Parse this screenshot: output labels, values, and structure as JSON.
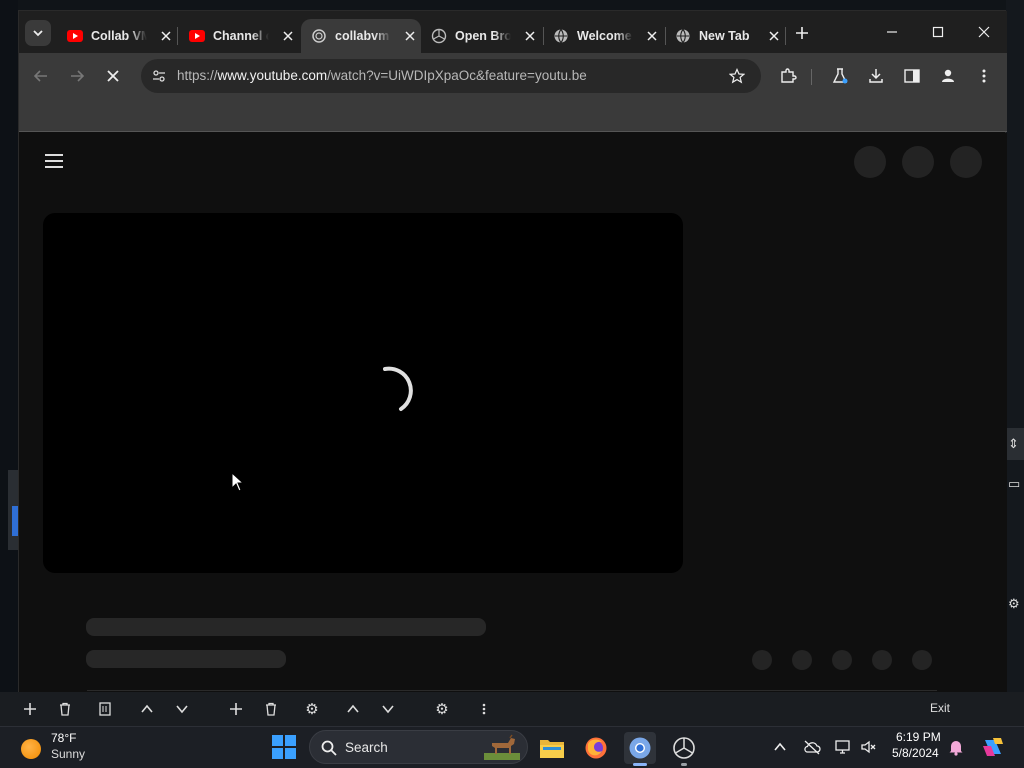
{
  "browser": {
    "tabs": [
      {
        "title": "Collab VM",
        "favicon": "youtube-icon",
        "active": false
      },
      {
        "title": "Channel c",
        "favicon": "youtube-icon",
        "active": false
      },
      {
        "title": "collabvm",
        "favicon": "loading-icon",
        "active": true
      },
      {
        "title": "Open Bro",
        "favicon": "openbrowser-icon",
        "active": false
      },
      {
        "title": "Welcome",
        "favicon": "globe-icon",
        "active": false
      },
      {
        "title": "New Tab",
        "favicon": "globe-icon",
        "active": false
      }
    ],
    "url_scheme": "https://",
    "url_domain": "www.youtube.com",
    "url_path": "/watch?v=UiWDIpXpaOc&feature=youtu.be",
    "loading": true
  },
  "app_strip": {
    "exit_label": "Exit"
  },
  "taskbar": {
    "weather_temp": "78°F",
    "weather_condition": "Sunny",
    "search_label": "Search",
    "clock_time": "6:19 PM",
    "clock_date": "5/8/2024",
    "apps": [
      "start-button",
      "search",
      "file-explorer",
      "firefox",
      "chrome",
      "open-browser"
    ]
  },
  "colors": {
    "youtube_red": "#ff0000",
    "accent_blue": "#3aa0ff",
    "page_background": "#0f0f0f",
    "placeholder": "#272727"
  }
}
